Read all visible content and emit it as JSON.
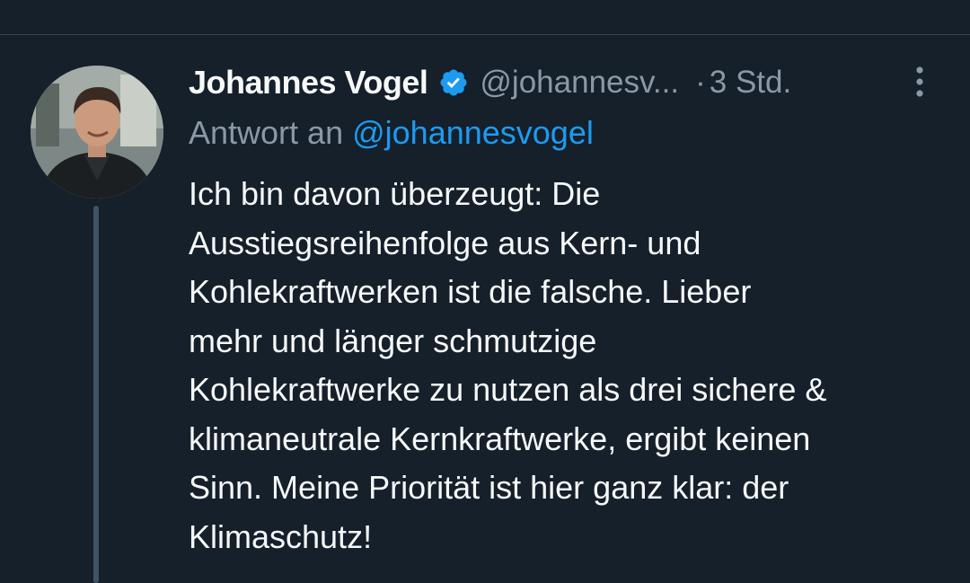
{
  "tweet": {
    "author_name": "Johannes Vogel",
    "handle": "@johannesv...",
    "separator": "·",
    "time": "3 Std.",
    "reply_prefix": "Antwort an",
    "reply_mention": "@johannesvogel",
    "body_lines": [
      "Ich bin davon überzeugt: Die",
      "Ausstiegsreihenfolge aus Kern- und",
      "Kohlekraftwerken ist die falsche. Lieber",
      "mehr und länger schmutzige",
      "Kohlekraftwerke zu nutzen als drei sichere &",
      "klimaneutrale Kernkraftwerke, ergibt keinen",
      "Sinn. Meine Priorität ist hier ganz klar: der",
      "Klimaschutz!"
    ]
  },
  "icons": {
    "verified": "verified-badge-icon",
    "more": "more-vertical-icon"
  },
  "colors": {
    "background": "#15202b",
    "text_primary": "#f7f9f9",
    "text_secondary": "#8b98a5",
    "accent": "#1d9bf0",
    "thread_line": "#3d5466"
  }
}
